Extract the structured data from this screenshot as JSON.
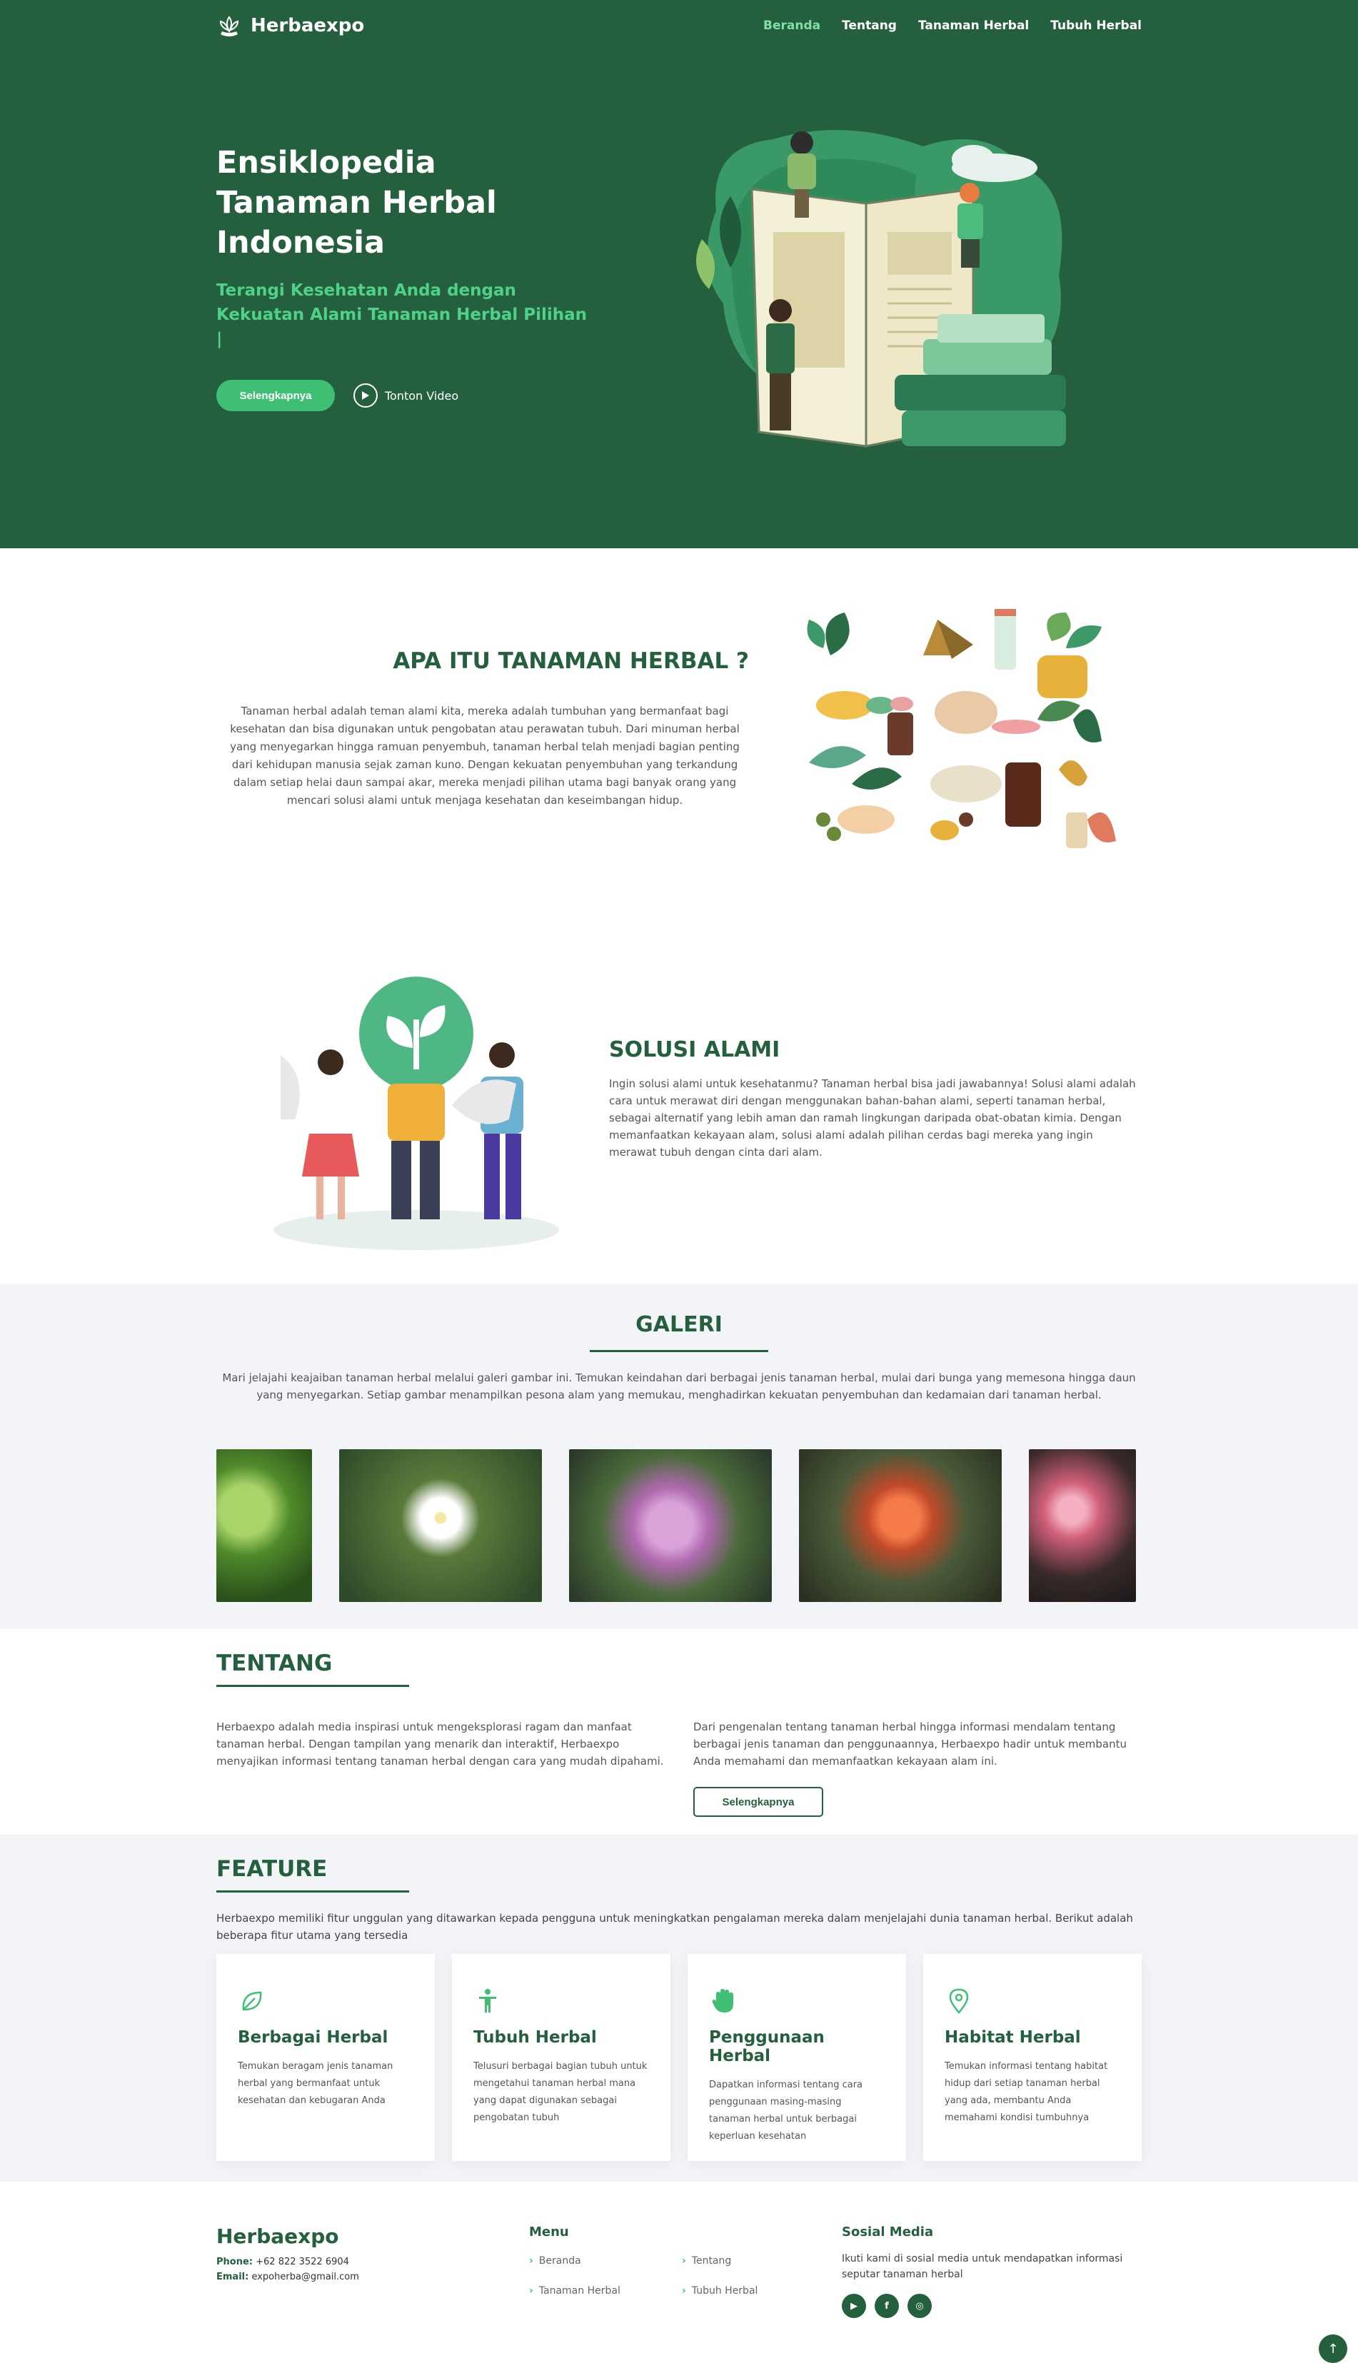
{
  "brand": "Herbaexpo",
  "nav": {
    "items": [
      {
        "label": "Beranda",
        "active": true
      },
      {
        "label": "Tentang",
        "active": false
      },
      {
        "label": "Tanaman Herbal",
        "active": false
      },
      {
        "label": "Tubuh Herbal",
        "active": false
      }
    ]
  },
  "hero": {
    "title": "Ensiklopedia Tanaman Herbal Indonesia",
    "subtitle": "Terangi Kesehatan Anda dengan Kekuatan Alami Tanaman Herbal Pilihan |",
    "primary_button": "Selengkapnya",
    "video_link": "Tonton Video"
  },
  "about": {
    "title": "APA ITU TANAMAN HERBAL ?",
    "text": "Tanaman herbal adalah teman alami kita, mereka adalah tumbuhan yang bermanfaat bagi kesehatan dan bisa digunakan untuk pengobatan atau perawatan tubuh. Dari minuman herbal yang menyegarkan hingga ramuan penyembuh, tanaman herbal telah menjadi bagian penting dari kehidupan manusia sejak zaman kuno. Dengan kekuatan penyembuhan yang terkandung dalam setiap helai daun sampai akar, mereka menjadi pilihan utama bagi banyak orang yang mencari solusi alami untuk menjaga kesehatan dan keseimbangan hidup."
  },
  "solusi": {
    "title": "SOLUSI ALAMI",
    "text": "Ingin solusi alami untuk kesehatanmu? Tanaman herbal bisa jadi jawabannya! Solusi alami adalah cara untuk merawat diri dengan menggunakan bahan-bahan alami, seperti tanaman herbal, sebagai alternatif yang lebih aman dan ramah lingkungan daripada obat-obatan kimia. Dengan memanfaatkan kekayaan alam, solusi alami adalah pilihan cerdas bagi mereka yang ingin merawat tubuh dengan cinta dari alam."
  },
  "galeri": {
    "title": "GALERI",
    "text": "Mari jelajahi keajaiban tanaman herbal melalui galeri gambar ini. Temukan keindahan dari berbagai jenis tanaman herbal, mulai dari bunga yang memesona hingga daun yang menyegarkan. Setiap gambar menampilkan pesona alam yang memukau, menghadirkan kekuatan penyembuhan dan kedamaian dari tanaman herbal."
  },
  "tentang": {
    "title": "TENTANG",
    "col1": "Herbaexpo adalah media inspirasi untuk mengeksplorasi ragam dan manfaat tanaman herbal. Dengan tampilan yang menarik dan interaktif, Herbaexpo menyajikan informasi tentang tanaman herbal dengan cara yang mudah dipahami.",
    "col2": "Dari pengenalan tentang tanaman herbal hingga informasi mendalam tentang berbagai jenis tanaman dan penggunaannya, Herbaexpo hadir untuk membantu Anda memahami dan memanfaatkan kekayaan alam ini.",
    "button": "Selengkapnya"
  },
  "feature": {
    "title": "FEATURE",
    "intro": "Herbaexpo memiliki fitur unggulan yang ditawarkan kepada pengguna untuk meningkatkan pengalaman mereka dalam menjelajahi dunia tanaman herbal. Berikut adalah beberapa fitur utama yang tersedia",
    "cards": [
      {
        "icon": "leaf-icon",
        "title": "Berbagai Herbal",
        "text": "Temukan beragam jenis tanaman herbal yang bermanfaat untuk kesehatan dan kebugaran Anda"
      },
      {
        "icon": "person-icon",
        "title": "Tubuh Herbal",
        "text": "Telusuri berbagai bagian tubuh untuk mengetahui tanaman herbal mana yang dapat digunakan sebagai pengobatan tubuh"
      },
      {
        "icon": "hand-icon",
        "title": "Penggunaan Herbal",
        "text": "Dapatkan informasi tentang cara penggunaan masing-masing tanaman herbal untuk berbagai keperluan kesehatan"
      },
      {
        "icon": "map-pin-icon",
        "title": "Habitat Herbal",
        "text": "Temukan informasi tentang habitat hidup dari setiap tanaman herbal yang ada, membantu Anda memahami kondisi tumbuhnya"
      }
    ]
  },
  "footer": {
    "brand": "Herbaexpo",
    "phone_label": "Phone:",
    "phone": "+62 822 3522 6904",
    "email_label": "Email:",
    "email": "expoherba@gmail.com",
    "menu_title": "Menu",
    "links": [
      "Beranda",
      "Tentang",
      "Tanaman Herbal",
      "Tubuh Herbal"
    ],
    "social_title": "Sosial Media",
    "social_text": "Ikuti kami di sosial media untuk mendapatkan informasi seputar tanaman herbal",
    "social_icons": [
      "youtube-icon",
      "facebook-icon",
      "instagram-icon"
    ]
  },
  "colors": {
    "primary": "#24603d",
    "accent": "#3fbf74",
    "light_bg": "#f2f4f8"
  }
}
